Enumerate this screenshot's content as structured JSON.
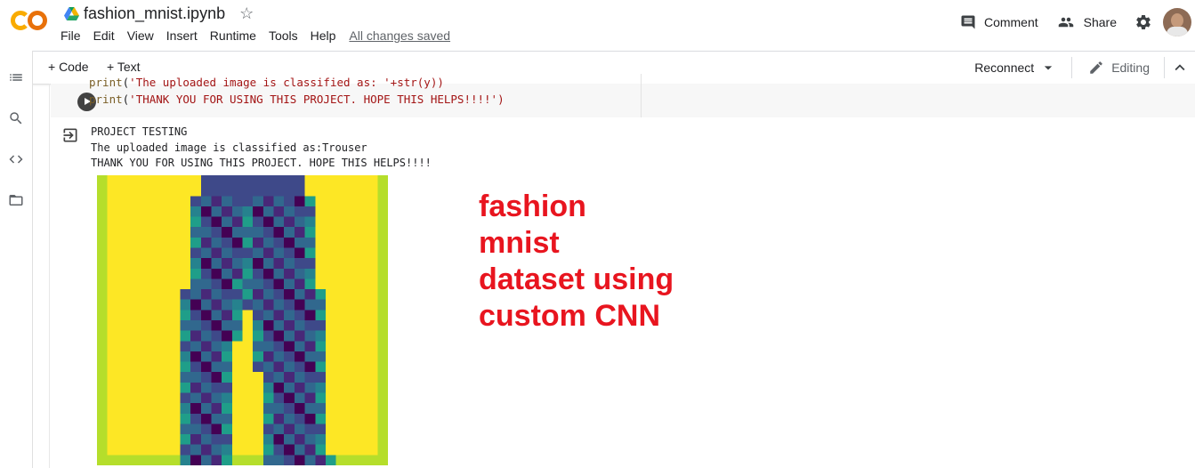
{
  "header": {
    "notebook_title": "fashion_mnist.ipynb",
    "menu": [
      "File",
      "Edit",
      "View",
      "Insert",
      "Runtime",
      "Tools",
      "Help"
    ],
    "save_status": "All changes saved",
    "comment_label": "Comment",
    "share_label": "Share"
  },
  "toolbar": {
    "add_code": "+ Code",
    "add_text": "+ Text",
    "connect_label": "Reconnect",
    "mode_label": "Editing"
  },
  "cell": {
    "code_lines": [
      {
        "fn": "print",
        "arg": "'The uploaded image is classified as: '+str(y))"
      },
      {
        "fn": "print",
        "arg": "'THANK YOU FOR USING THIS PROJECT. HOPE THIS HELPS!!!!')"
      }
    ],
    "output_lines": [
      "PROJECT TESTING",
      "The uploaded image is classified as:Trouser",
      "THANK YOU FOR USING THIS PROJECT. HOPE THIS HELPS!!!!"
    ]
  },
  "overlay_lines": [
    "fashion",
    "mnist",
    "dataset using",
    "custom CNN"
  ],
  "colors": {
    "overlay_text": "#e8151f",
    "viridis_yellow": "#fde725",
    "viridis_purple": "#440154",
    "colab_orange": "#f9ab00"
  },
  "icons": [
    "colab-logo-icon",
    "drive-icon",
    "star-icon",
    "comment-icon",
    "share-people-icon",
    "gear-icon",
    "avatar",
    "toc-icon",
    "search-icon",
    "code-snippets-icon",
    "folder-icon",
    "run-icon",
    "output-icon",
    "chevron-down-icon",
    "pencil-icon",
    "chevron-up-icon"
  ]
}
